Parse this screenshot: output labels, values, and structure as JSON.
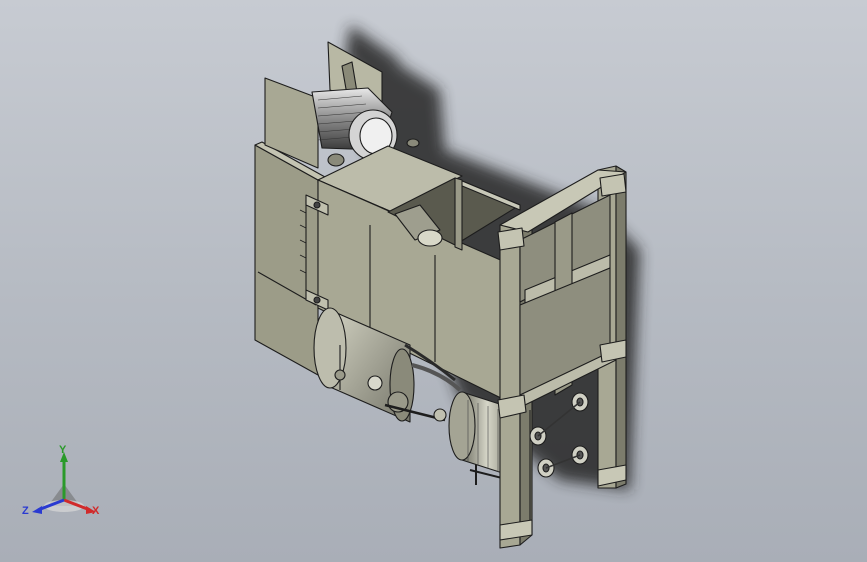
{
  "viewport": {
    "background_top": "#c7cbd2",
    "background_bottom": "#a9aeb7"
  },
  "model": {
    "part_color": "#a8a894",
    "shadow_color": "#262626"
  },
  "triad": {
    "x_label": "X",
    "y_label": "Y",
    "z_label": "Z",
    "x_color": "#d12a2a",
    "y_color": "#2a9a2a",
    "z_color": "#2a3ad1"
  }
}
